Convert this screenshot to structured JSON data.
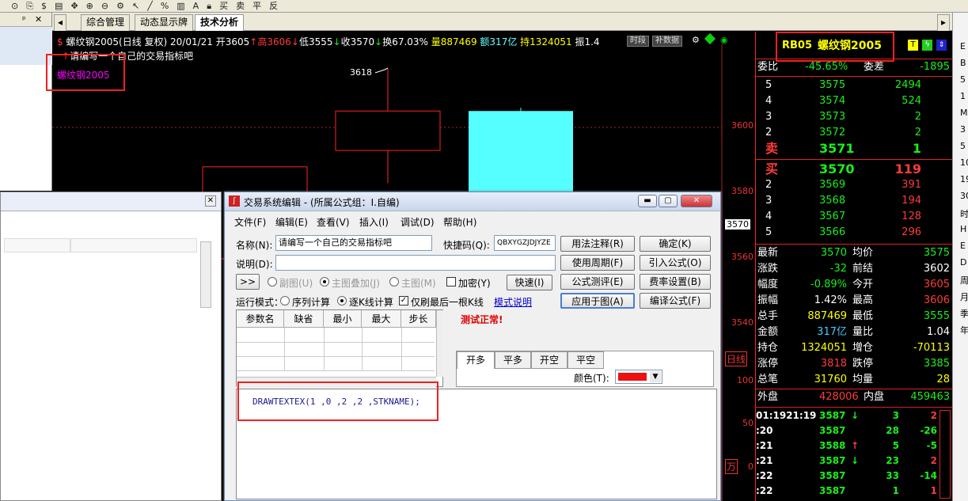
{
  "toolbar": {
    "labels": [
      "买",
      "卖",
      "平",
      "反"
    ]
  },
  "left_pane": {
    "pin": "ᵖ",
    "close": "✕"
  },
  "tabs": [
    {
      "label": "综合管理"
    },
    {
      "label": "动态显示牌"
    },
    {
      "label": "技术分析"
    }
  ],
  "chart": {
    "info": {
      "name": "螺纹钢2005(日线 复权)",
      "date": "20/01/21",
      "open": "开3605",
      "high": "高3606",
      "low": "低3555",
      "close": "收3570",
      "turnover": "换67.03%",
      "volume": "量887469",
      "amount": "额317亿",
      "hold": "持1324051",
      "amp": "振1.4"
    },
    "buttons": {
      "intraday": "时段",
      "fill": "补数据"
    },
    "formula_line": "请编写一个自己的交易指标吧",
    "drawn_text": "螺纹钢2005",
    "peak_label": "3618",
    "price_ticks": [
      "3600",
      "3580",
      "3560",
      "3540"
    ],
    "current_price": "3570",
    "period_label": "日线",
    "vol_ticks": [
      "100",
      "50",
      "0"
    ],
    "vol_unit": "万",
    "chart_data": {
      "type": "candlestick",
      "candles": [
        {
          "open": 3560,
          "close": 3588,
          "high": 3588,
          "low": 3480,
          "color": "red-hollow"
        },
        {
          "open": 3605,
          "close": 3593,
          "high": 3618,
          "low": 3583,
          "color": "red-hollow"
        },
        {
          "open": 3605,
          "close": 3570,
          "high": 3606,
          "low": 3555,
          "color": "cyan"
        }
      ],
      "ylim": [
        3530,
        3630
      ]
    }
  },
  "panel": {
    "title_code": "RB05",
    "title_name": "螺纹钢2005",
    "weibi_label": "委比",
    "weibi_val": "-45.65%",
    "weicha_label": "委差",
    "weicha_val": "-1895",
    "asks": [
      {
        "level": "5",
        "price": "3575",
        "vol": "2494"
      },
      {
        "level": "4",
        "price": "3574",
        "vol": "524"
      },
      {
        "level": "3",
        "price": "3573",
        "vol": "2"
      },
      {
        "level": "2",
        "price": "3572",
        "vol": "2"
      },
      {
        "level": "卖",
        "price": "3571",
        "vol": "1"
      }
    ],
    "bids": [
      {
        "level": "买",
        "price": "3570",
        "vol": "119"
      },
      {
        "level": "2",
        "price": "3569",
        "vol": "391"
      },
      {
        "level": "3",
        "price": "3568",
        "vol": "194"
      },
      {
        "level": "4",
        "price": "3567",
        "vol": "128"
      },
      {
        "level": "5",
        "price": "3566",
        "vol": "296"
      }
    ],
    "stats": [
      {
        "l1": "最新",
        "v1": "3570",
        "c1": "gr",
        "l2": "均价",
        "v2": "3575",
        "c2": "gr"
      },
      {
        "l1": "涨跌",
        "v1": "-32",
        "c1": "gr",
        "l2": "前结",
        "v2": "3602",
        "c2": "wh"
      },
      {
        "l1": "幅度",
        "v1": "-0.89%",
        "c1": "gr",
        "l2": "今开",
        "v2": "3605",
        "c2": "rd"
      },
      {
        "l1": "振幅",
        "v1": "1.42%",
        "c1": "wh",
        "l2": "最高",
        "v2": "3606",
        "c2": "rd"
      },
      {
        "l1": "总手",
        "v1": "887469",
        "c1": "yl",
        "l2": "最低",
        "v2": "3555",
        "c2": "gr"
      },
      {
        "l1": "金额",
        "v1": "317亿",
        "c1": "cy",
        "l2": "量比",
        "v2": "1.04",
        "c2": "wh"
      },
      {
        "l1": "持仓",
        "v1": "1324051",
        "c1": "yl",
        "l2": "增仓",
        "v2": "-70113",
        "c2": "yl"
      },
      {
        "l1": "涨停",
        "v1": "3818",
        "c1": "rd",
        "l2": "跌停",
        "v2": "3385",
        "c2": "gr"
      },
      {
        "l1": "总笔",
        "v1": "31760",
        "c1": "yl",
        "l2": "均量",
        "v2": "28",
        "c2": "yl"
      }
    ],
    "outer_label": "外盘",
    "outer_val": "428006",
    "inner_label": "内盘",
    "inner_val": "459463",
    "ticks": [
      {
        "time": "01:1921:19",
        "price": "3587",
        "arrow": "↓",
        "ac": "gr",
        "vol": "3",
        "chg": "2",
        "cc": "rd"
      },
      {
        "time": ":20",
        "price": "3587",
        "arrow": "",
        "ac": "wh",
        "vol": "28",
        "chg": "-26",
        "cc": "gr"
      },
      {
        "time": ":21",
        "price": "3588",
        "arrow": "↑",
        "ac": "rd",
        "vol": "5",
        "chg": "-5",
        "cc": "gr"
      },
      {
        "time": ":21",
        "price": "3587",
        "arrow": "↓",
        "ac": "gr",
        "vol": "23",
        "chg": "2",
        "cc": "rd"
      },
      {
        "time": ":22",
        "price": "3587",
        "arrow": "",
        "ac": "wh",
        "vol": "33",
        "chg": "-14",
        "cc": "gr"
      },
      {
        "time": ":22",
        "price": "3587",
        "arrow": "",
        "ac": "wh",
        "vol": "1",
        "chg": "1",
        "cc": "rd"
      }
    ]
  },
  "rside": {
    "chars": [
      "E",
      "B",
      "5",
      "1",
      "M",
      "3",
      "5",
      "10",
      "19",
      "30",
      "时",
      "H",
      "E",
      "D",
      "周",
      "月",
      "季",
      "年"
    ]
  },
  "dialog": {
    "title": "交易系统编辑 - (所属公式组：I.自编)",
    "menu": [
      "文件(F)",
      "编辑(E)",
      "查看(V)",
      "插入(I)",
      "调试(D)",
      "帮助(H)"
    ],
    "name_label": "名称(N):",
    "name_value": "请编写一个自己的交易指标吧",
    "shortcut_label": "快捷码(Q):",
    "shortcut_value": "QBXYGZJDJYZE",
    "desc_label": "说明(D):",
    "expand_btn": ">>",
    "radio_sub": "副图(U)",
    "radio_overlay": "主图叠加(J)",
    "radio_main": "主图(M)",
    "encrypt": "加密(Y)",
    "fast_btn": "快速(I)",
    "mode_label": "运行模式：",
    "mode_seq": "序列计算",
    "mode_k": "逐K线计算",
    "last_k": "仅刷最后一根K线",
    "mode_help": "模式说明",
    "param_headers": [
      "参数名",
      "缺省",
      "最小",
      "最大",
      "步长"
    ],
    "test_status": "测试正常!",
    "signal_tabs": [
      "开多",
      "平多",
      "开空",
      "平空"
    ],
    "color_label": "颜色(T):",
    "code": "DRAWTEXTEX(1 ,0 ,2 ,2 ,STKNAME);",
    "buttons": {
      "usage": "用法注释(R)",
      "ok": "确定(K)",
      "period": "使用周期(F)",
      "import": "引入公式(O)",
      "eval": "公式测评(E)",
      "fee": "费率设置(B)",
      "apply": "应用于图(A)",
      "compile": "编译公式(F)"
    }
  }
}
